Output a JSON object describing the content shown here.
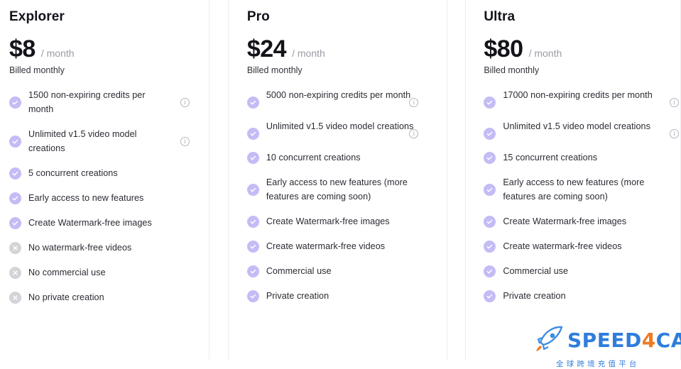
{
  "plans": [
    {
      "id": "explorer",
      "name": "Explorer",
      "price": "$8",
      "period": "/ month",
      "billing_note": "Billed monthly",
      "features": [
        {
          "text": "1500 non-expiring credits per month",
          "state": "included",
          "info": true,
          "lines": 2
        },
        {
          "text": "Unlimited v1.5 video model creations",
          "state": "included",
          "info": true,
          "lines": 2
        },
        {
          "text": "5 concurrent creations",
          "state": "included",
          "info": false,
          "lines": 1
        },
        {
          "text": "Early access to new features",
          "state": "included",
          "info": false,
          "lines": 1
        },
        {
          "text": "Create Watermark-free images",
          "state": "included",
          "info": false,
          "lines": 1
        },
        {
          "text": "No watermark-free videos",
          "state": "excluded",
          "info": false,
          "lines": 1
        },
        {
          "text": "No commercial use",
          "state": "excluded",
          "info": false,
          "lines": 1
        },
        {
          "text": "No private creation",
          "state": "excluded",
          "info": false,
          "lines": 1
        }
      ]
    },
    {
      "id": "pro",
      "name": "Pro",
      "price": "$24",
      "period": "/ month",
      "billing_note": "Billed monthly",
      "features": [
        {
          "text": "5000 non-expiring credits per month",
          "state": "included",
          "info": true,
          "lines": 2
        },
        {
          "text": "Unlimited v1.5 video model creations",
          "state": "included",
          "info": true,
          "lines": 2
        },
        {
          "text": "10 concurrent creations",
          "state": "included",
          "info": false,
          "lines": 1
        },
        {
          "text": "Early access to new features (more features are coming soon)",
          "state": "included",
          "info": false,
          "lines": 2
        },
        {
          "text": "Create Watermark-free images",
          "state": "included",
          "info": false,
          "lines": 1
        },
        {
          "text": "Create watermark-free videos",
          "state": "included",
          "info": false,
          "lines": 1
        },
        {
          "text": "Commercial use",
          "state": "included",
          "info": false,
          "lines": 1
        },
        {
          "text": "Private creation",
          "state": "included",
          "info": false,
          "lines": 1
        }
      ]
    },
    {
      "id": "ultra",
      "name": "Ultra",
      "price": "$80",
      "period": "/ month",
      "billing_note": "Billed monthly",
      "features": [
        {
          "text": "17000 non-expiring credits per month",
          "state": "included",
          "info": true,
          "lines": 2
        },
        {
          "text": "Unlimited v1.5 video model creations",
          "state": "included",
          "info": true,
          "lines": 2
        },
        {
          "text": "15 concurrent creations",
          "state": "included",
          "info": false,
          "lines": 1
        },
        {
          "text": "Early access to new features (more features are coming soon)",
          "state": "included",
          "info": false,
          "lines": 2
        },
        {
          "text": "Create Watermark-free images",
          "state": "included",
          "info": false,
          "lines": 1
        },
        {
          "text": "Create watermark-free videos",
          "state": "included",
          "info": false,
          "lines": 1
        },
        {
          "text": "Commercial use",
          "state": "included",
          "info": false,
          "lines": 1
        },
        {
          "text": "Private creation",
          "state": "included",
          "info": false,
          "lines": 1
        }
      ]
    }
  ],
  "icons": {
    "check": "check-circle-icon",
    "cross": "x-circle-icon",
    "info": "info-icon",
    "info_glyph": "i"
  },
  "watermark": {
    "brand_part1": "SPEED",
    "brand_part2": "4",
    "brand_part3": "CARD",
    "subtitle": "全球跨境充值平台",
    "logo": "rocket-icon"
  },
  "colors": {
    "included_icon": "#c3bcf5",
    "excluded_icon": "#d3d3d8",
    "price_text": "#14131a",
    "period_text": "#9b9aa4",
    "card_border": "#ececf0",
    "watermark_blue": "#2f7ddb",
    "watermark_orange": "#ef7b21"
  }
}
